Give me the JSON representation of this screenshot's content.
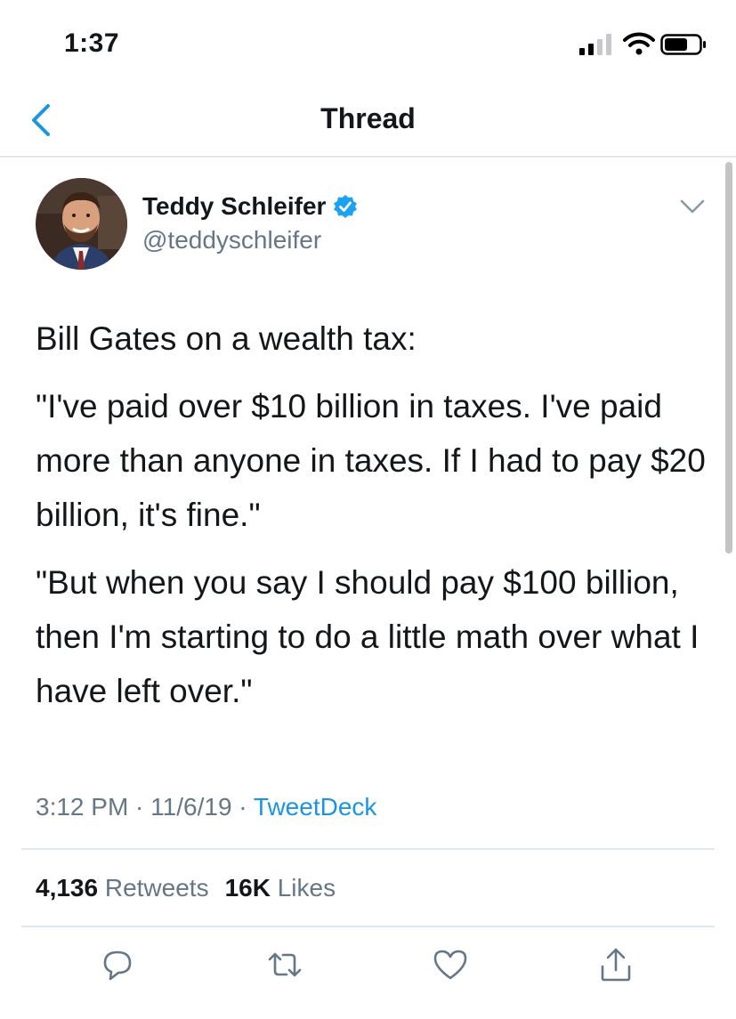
{
  "status_bar": {
    "time": "1:37"
  },
  "nav": {
    "title": "Thread"
  },
  "tweet": {
    "author_name": "Teddy Schleifer",
    "author_handle": "@teddyschleifer",
    "paragraphs": [
      "Bill Gates on a wealth tax:",
      "\"I've paid over $10 billion in taxes. I've paid more than anyone in taxes. If I had to pay $20 billion, it's fine.\"",
      "\"But when you say I should pay $100 billion, then I'm starting to do a little math over what I have left over.\""
    ],
    "time": "3:12 PM",
    "date": "11/6/19",
    "separator": " · ",
    "source": "TweetDeck",
    "retweets_count": "4,136",
    "retweets_label": "Retweets",
    "likes_count": "16K",
    "likes_label": "Likes"
  },
  "icons": {
    "back": "chevron-left-icon",
    "verified": "verified-badge-icon",
    "menu": "chevron-down-icon",
    "reply": "reply-icon",
    "retweet": "retweet-icon",
    "like": "heart-icon",
    "share": "share-icon"
  },
  "colors": {
    "accent": "#1b95e0",
    "secondary_text": "#657786",
    "action_gray": "#657786",
    "divider": "#e1e8ed"
  }
}
